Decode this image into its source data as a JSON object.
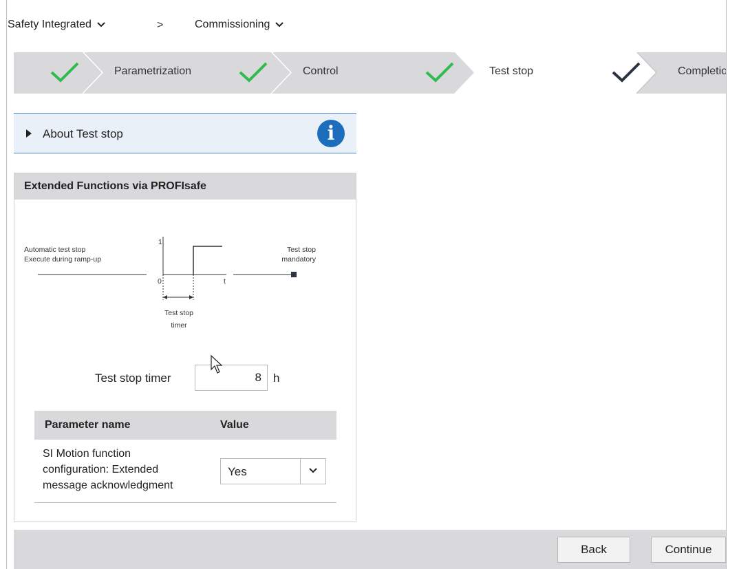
{
  "breadcrumb": {
    "item1": "Safety Integrated",
    "separator": ">",
    "item2": "Commissioning"
  },
  "wizard": {
    "steps": [
      {
        "label": "",
        "status": "done"
      },
      {
        "label": "Parametrization",
        "status": "done"
      },
      {
        "label": "Control",
        "status": "done"
      },
      {
        "label": "Test stop",
        "status": "current"
      },
      {
        "label": "Completio",
        "status": "pending"
      }
    ],
    "colors": {
      "done_check": "#2ebc4f",
      "current_check": "#2b3440",
      "inactive_bg": "#d9d9dc",
      "active_bg": "#ffffff"
    }
  },
  "about": {
    "label": "About Test stop",
    "info_glyph": "i",
    "icon": "info-icon"
  },
  "section": {
    "title": "Extended Functions via PROFIsafe",
    "diagram": {
      "left_line1": "Automatic test stop",
      "left_line2": "Execute during ramp-up",
      "y_tick": "1",
      "x_origin": "0",
      "x_axis": "t",
      "right_line1": "Test stop",
      "right_line2": "mandatory",
      "timer_line1": "Test stop",
      "timer_line2": "timer"
    },
    "timer": {
      "label": "Test stop timer",
      "value": "8",
      "unit": "h"
    },
    "table": {
      "headers": [
        "Parameter name",
        "Value"
      ],
      "rows": [
        {
          "name_lines": [
            "SI Motion function",
            "configuration: Extended",
            "message acknowledgment"
          ],
          "value": "Yes"
        }
      ]
    }
  },
  "footer": {
    "back": "Back",
    "continue": "Continue"
  },
  "colors": {
    "accent_blue": "#1c6ebd",
    "panel_gray": "#d9d9dc",
    "info_bg": "#eaf0f7"
  }
}
